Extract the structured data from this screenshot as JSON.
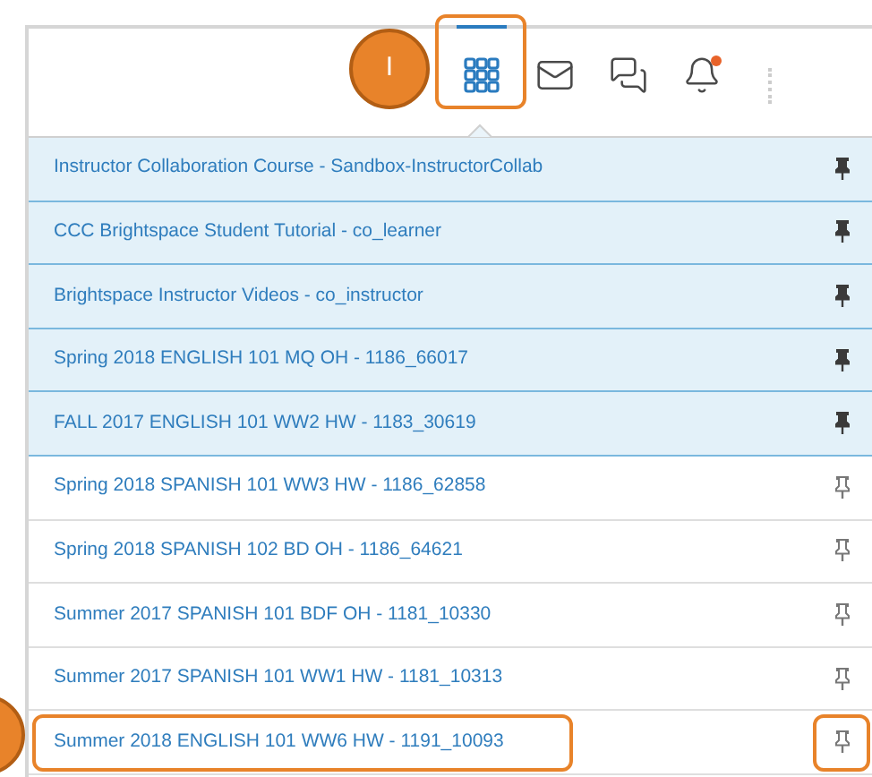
{
  "callouts": [
    {
      "kind": "numbered",
      "label": "I"
    },
    {
      "kind": "bare"
    }
  ],
  "toolbar": [
    {
      "kind": "grid",
      "selected": true,
      "highlighted": true
    },
    {
      "kind": "mail",
      "selected": false,
      "highlighted": false
    },
    {
      "kind": "chat",
      "selected": false,
      "highlighted": false
    },
    {
      "kind": "bell",
      "selected": false,
      "highlighted": false,
      "badge": true
    }
  ],
  "courses": [
    {
      "name": "Instructor Collaboration Course - Sandbox-InstructorCollab",
      "pinned": true,
      "highlighted": false
    },
    {
      "name": "CCC Brightspace Student Tutorial - co_learner",
      "pinned": true,
      "highlighted": false
    },
    {
      "name": "Brightspace Instructor Videos - co_instructor",
      "pinned": true,
      "highlighted": false
    },
    {
      "name": "Spring 2018 ENGLISH 101 MQ OH - 1186_66017",
      "pinned": true,
      "highlighted": false
    },
    {
      "name": "FALL 2017 ENGLISH 101 WW2 HW - 1183_30619",
      "pinned": true,
      "highlighted": false
    },
    {
      "name": "Spring 2018 SPANISH 101 WW3 HW - 1186_62858",
      "pinned": false,
      "highlighted": false
    },
    {
      "name": "Spring 2018 SPANISH 102 BD OH - 1186_64621",
      "pinned": false,
      "highlighted": false
    },
    {
      "name": "Summer 2017 SPANISH 101 BDF OH - 1181_10330",
      "pinned": false,
      "highlighted": false
    },
    {
      "name": "Summer 2017 SPANISH 101 WW1 HW - 1181_10313",
      "pinned": false,
      "highlighted": false
    },
    {
      "name": "Summer 2018 ENGLISH 101 WW6 HW - 1191_10093",
      "pinned": false,
      "highlighted": true
    }
  ]
}
